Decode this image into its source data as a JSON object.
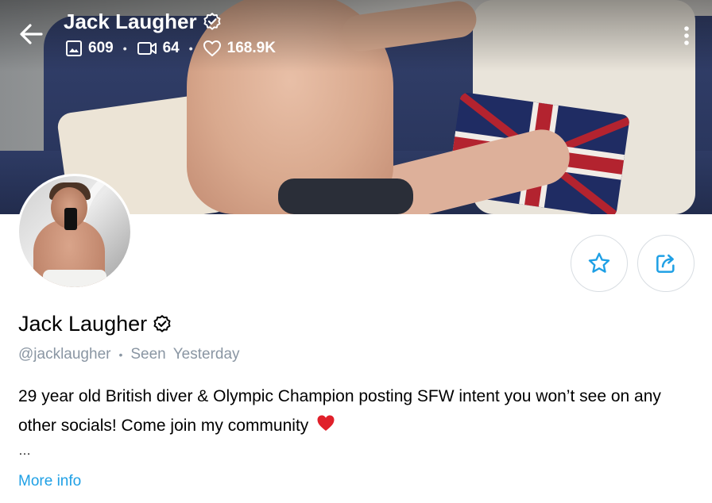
{
  "header": {
    "title": "Jack Laugher",
    "stats": {
      "photos": "609",
      "videos": "64",
      "likes": "168.9K"
    }
  },
  "profile": {
    "name": "Jack Laugher",
    "handle": "@jacklaugher",
    "separator": "•",
    "seen_label": "Seen",
    "seen_value": "Yesterday",
    "bio": "29 year old British diver & Olympic Champion posting SFW intent you won’t see on any other socials! Come join my community",
    "ellipsis": "…",
    "more_info": "More info"
  },
  "icons": {
    "back": "arrow-left-icon",
    "verified": "verified-badge-icon",
    "photo": "image-icon",
    "video": "video-icon",
    "like": "heart-outline-icon",
    "more": "vertical-dots-icon",
    "favorite": "star-icon",
    "share": "share-icon",
    "emoji": "red-heart-emoji"
  },
  "colors": {
    "accent": "#1fa0e5",
    "muted_text": "#8a96a3",
    "button_border": "#d8dde2",
    "emoji_heart": "#e0202a"
  }
}
